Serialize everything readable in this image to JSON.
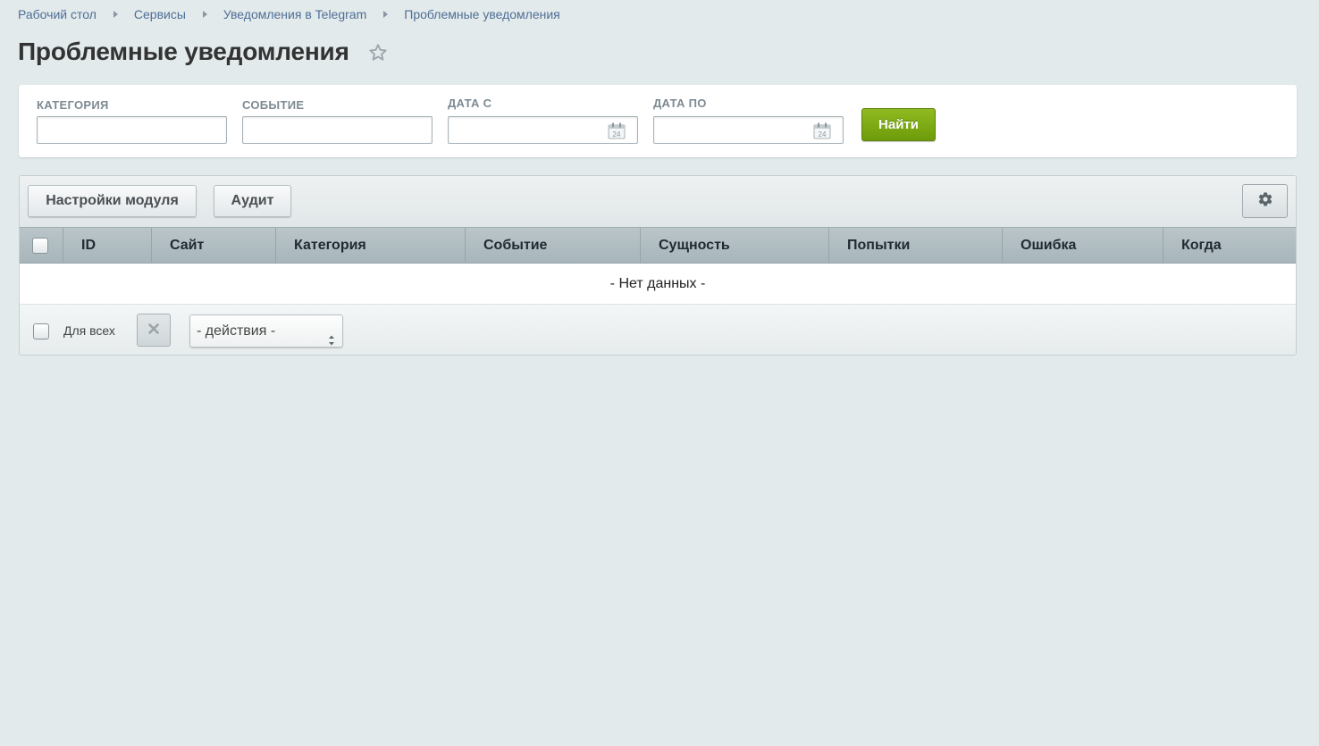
{
  "breadcrumbs": [
    {
      "label": "Рабочий стол"
    },
    {
      "label": "Сервисы"
    },
    {
      "label": "Уведомления в Telegram"
    },
    {
      "label": "Проблемные уведомления"
    }
  ],
  "page": {
    "title": "Проблемные уведомления"
  },
  "filter": {
    "category_label": "КАТЕГОРИЯ",
    "category_value": "",
    "event_label": "СОБЫТИЕ",
    "event_value": "",
    "date_from_label": "ДАТА С",
    "date_from_value": "",
    "date_to_label": "ДАТА ПО",
    "date_to_value": "",
    "calendar_icon_text": "24",
    "find_label": "Найти"
  },
  "toolbar": {
    "module_settings_label": "Настройки модуля",
    "audit_label": "Аудит"
  },
  "grid": {
    "columns": [
      "ID",
      "Сайт",
      "Категория",
      "Событие",
      "Сущность",
      "Попытки",
      "Ошибка",
      "Когда"
    ],
    "empty_text": "- Нет данных -"
  },
  "footer": {
    "for_all_label": "Для всех",
    "actions_value": "- действия -"
  },
  "colors": {
    "accent_green": "#7aa614",
    "link_blue": "#4e6e96"
  }
}
